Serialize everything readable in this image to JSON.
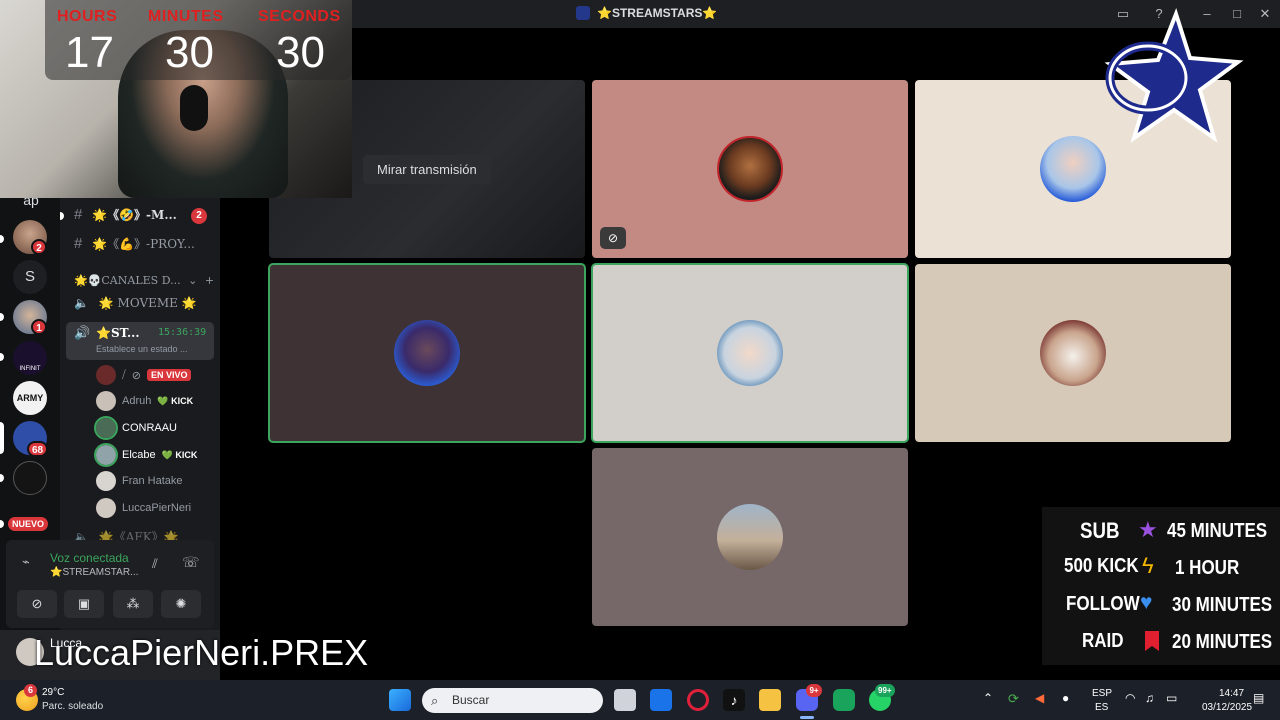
{
  "titlebar": {
    "title": "⭐STREAMSTARS⭐"
  },
  "timer": {
    "labels": [
      "HOURS",
      "MINUTES",
      "SECONDS"
    ],
    "values": [
      "17",
      "30",
      "30"
    ]
  },
  "server_rail": {
    "letter_ap": "ap",
    "letter_s": "S",
    "badges": [
      "2",
      "1",
      "68"
    ],
    "nuevo": "NUEVO",
    "army_label": "ARMY",
    "infinit_label": "INFINIT"
  },
  "channels": {
    "items": [
      {
        "icon": "#",
        "label": "🌟《🤣》-M...",
        "badge": "2"
      },
      {
        "icon": "#",
        "label": "🌟《💪》-PROY..."
      },
      {
        "label": "🌟💀CANALES D..."
      },
      {
        "label": "🌟 MOVEME 🌟"
      }
    ],
    "active_voice": {
      "name": "⭐ST...",
      "time": "15:36:39",
      "status": "Establece un estado ..."
    },
    "members": [
      {
        "name": "",
        "tag": "EN VIVO"
      },
      {
        "name": "Adruh",
        "tag": "💚 KICK"
      },
      {
        "name": "CONRAAU",
        "tag": ""
      },
      {
        "name": "Elcabe",
        "tag": "💚 KICK"
      },
      {
        "name": "Fran Hatake",
        "tag": ""
      },
      {
        "name": "LuccaPierNeri",
        "tag": ""
      }
    ],
    "afk": "🌟《AFK》🌟"
  },
  "voice_panel": {
    "status": "Voz conectada",
    "channel": "⭐STREAMSTAR..."
  },
  "user": {
    "name": "Lucca"
  },
  "stage": {
    "watch_button": "Mirar transmisión"
  },
  "name_overlay": "LuccaPierNeri.PREX",
  "goals": [
    {
      "left": "SUB",
      "right": "45 MINUTES",
      "icon": "star"
    },
    {
      "left": "500 KICK",
      "right": "1 HOUR",
      "icon": "bolt"
    },
    {
      "left": "FOLLOW",
      "right": "30 MINUTES",
      "icon": "heart"
    },
    {
      "left": "RAID",
      "right": "20 MINUTES",
      "icon": "flag"
    }
  ],
  "taskbar": {
    "weather_temp": "29°C",
    "weather_desc": "Parc. soleado",
    "weather_badge": "6",
    "search_placeholder": "Buscar",
    "discord_badge": "9+",
    "whatsapp_badge": "99+",
    "lang_top": "ESP",
    "lang_bottom": "ES",
    "time": "14:47",
    "date": "03/12/2025"
  },
  "colors": {
    "discord_bg": "#1a1b1e",
    "speaking_green": "#3ba55d",
    "live_red": "#da373c"
  }
}
